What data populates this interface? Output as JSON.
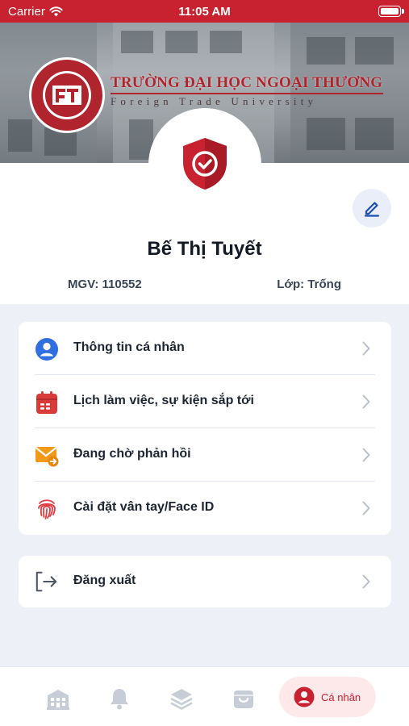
{
  "status_bar": {
    "carrier": "Carrier",
    "time": "11:05 AM"
  },
  "header": {
    "university_name": "TRƯỜNG ĐẠI HỌC NGOẠI THƯƠNG",
    "university_subtitle": "Foreign Trade University"
  },
  "profile": {
    "name": "Bế Thị Tuyết",
    "mgv": "MGV: 110552",
    "lop": "Lớp: Trống"
  },
  "menu": {
    "items": [
      {
        "label": "Thông tin cá nhân",
        "icon": "user-circle-icon"
      },
      {
        "label": "Lịch làm việc, sự kiện sắp tới",
        "icon": "calendar-icon"
      },
      {
        "label": "Đang chờ phản hồi",
        "icon": "mail-forward-icon"
      },
      {
        "label": "Cài đặt vân tay/Face ID",
        "icon": "fingerprint-icon"
      }
    ],
    "logout": {
      "label": "Đăng xuất",
      "icon": "logout-icon"
    }
  },
  "tabbar": {
    "active_label": "Cá nhân",
    "tabs": [
      "building-icon",
      "bell-icon",
      "layers-icon",
      "shopping-bag-icon",
      "user-icon"
    ]
  },
  "colors": {
    "brand_red": "#c8212f",
    "menu_blue": "#2f6fe0",
    "calendar_red": "#d93a3a",
    "mail_orange": "#f29a18"
  }
}
